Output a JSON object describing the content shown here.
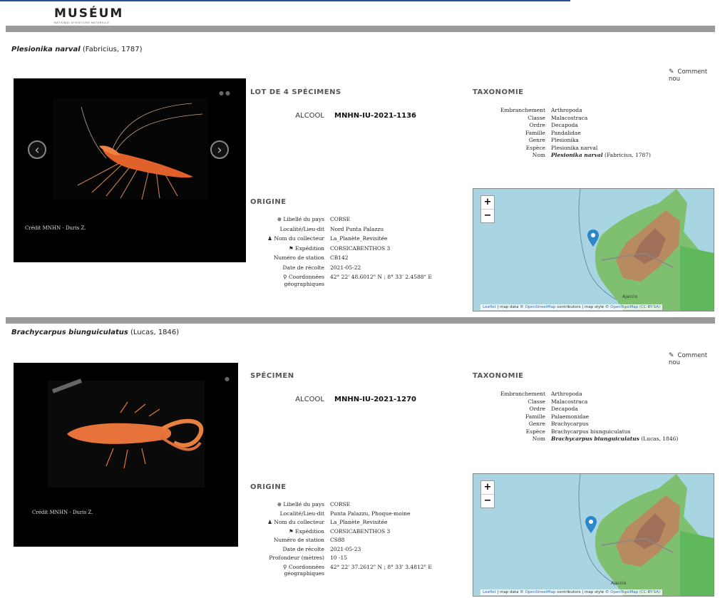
{
  "logo": {
    "main": "MUSÉUM",
    "sub": "NATIONAL D'HISTOIRE NATURELLE"
  },
  "records": [
    {
      "species_name": "Plesionika narval",
      "species_author": "(Fabricius, 1787)",
      "comment_label": "Comment nou",
      "credit": "Crédit MNHN - Duris Z.",
      "lot_title": "LOT DE 4 SPÉCIMENS",
      "lot_type": "ALCOOL",
      "lot_id": "MNHN-IU-2021-1136",
      "origin_title": "ORIGINE",
      "origin": {
        "country_label": "Libellé du pays",
        "country": "CORSE",
        "locality_label": "Localité/Lieu-dit",
        "locality": "Nord Punta Palazzu",
        "collector_label": "Nom du collecteur",
        "collector": "La_Planète_Revisitée",
        "expedition_label": "Expédition",
        "expedition": "CORSICABENTHOS 3",
        "station_label": "Numéro de station",
        "station": "CB142",
        "date_label": "Date de récolte",
        "date": "2021-05-22",
        "coords_label": "Coordonnées géographiques",
        "coords": "42° 22' 48.6012\" N ; 8° 33' 2.4588\" E"
      },
      "taxo_title": "TAXONOMIE",
      "taxonomy": {
        "phylum_label": "Embranchement",
        "phylum": "Arthropoda",
        "class_label": "Classe",
        "class": "Malacostraca",
        "order_label": "Ordre",
        "order": "Decapoda",
        "family_label": "Famille",
        "family": "Pandalidae",
        "genus_label": "Genre",
        "genus": "Plesionika",
        "species_label": "Espèce",
        "species": "Plesionika narval",
        "name_label": "Nom",
        "name": "Plesionika narval",
        "name_author": "(Fabricius, 1787)"
      },
      "map": {
        "zoom_in": "+",
        "zoom_out": "−",
        "city": "Ajaccio",
        "attribution_leaflet": "Leaflet",
        "attribution_mid": " | map data © ",
        "attribution_osm": "OpenStreetMap",
        "attribution_rest": " contributors | map style © ",
        "attribution_otm": "OpenTopoMap",
        "attribution_end": " (CC-BY-SA)"
      }
    },
    {
      "species_name": "Brachycarpus biunguiculatus",
      "species_author": "(Lucas, 1846)",
      "comment_label": "Comment nou",
      "credit": "Crédit MNHN - Duris Z.",
      "lot_title": "SPÉCIMEN",
      "lot_type": "ALCOOL",
      "lot_id": "MNHN-IU-2021-1270",
      "origin_title": "ORIGINE",
      "origin": {
        "country_label": "Libellé du pays",
        "country": "CORSE",
        "locality_label": "Localité/Lieu-dit",
        "locality": "Punta Palazzu, Phoque-moine",
        "collector_label": "Nom du collecteur",
        "collector": "La_Planète_Revisitée",
        "expedition_label": "Expédition",
        "expedition": "CORSICABENTHOS 3",
        "station_label": "Numéro de station",
        "station": "CS88",
        "date_label": "Date de récolte",
        "date": "2021-05-23",
        "depth_label": "Profondeur (mètres)",
        "depth": "10 -15",
        "coords_label": "Coordonnées géographiques",
        "coords": "42° 22' 37.2612\" N ; 8° 33' 3.4812\" E"
      },
      "taxo_title": "TAXONOMIE",
      "taxonomy": {
        "phylum_label": "Embranchement",
        "phylum": "Arthropoda",
        "class_label": "Classe",
        "class": "Malacostraca",
        "order_label": "Ordre",
        "order": "Decapoda",
        "family_label": "Famille",
        "family": "Palaemonidae",
        "genus_label": "Genre",
        "genus": "Brachycarpus",
        "species_label": "Espèce",
        "species": "Brachycarpus biunguiculatus",
        "name_label": "Nom",
        "name": "Brachycarpus biunguiculatus",
        "name_author": "(Lucas, 1846)"
      },
      "map": {
        "zoom_in": "+",
        "zoom_out": "−",
        "city": "Ajaccio",
        "attribution_leaflet": "Leaflet",
        "attribution_mid": " | map data © ",
        "attribution_osm": "OpenStreetMap",
        "attribution_rest": " contributors | map style © ",
        "attribution_otm": "OpenTopoMap",
        "attribution_end": " (CC-BY-SA)"
      }
    }
  ],
  "icons": [
    "globe-icon",
    "user-icon",
    "flag-icon",
    "map-pin-icon",
    "pencil-icon",
    "chevron-left-icon",
    "chevron-right-icon",
    "map-marker-icon"
  ]
}
